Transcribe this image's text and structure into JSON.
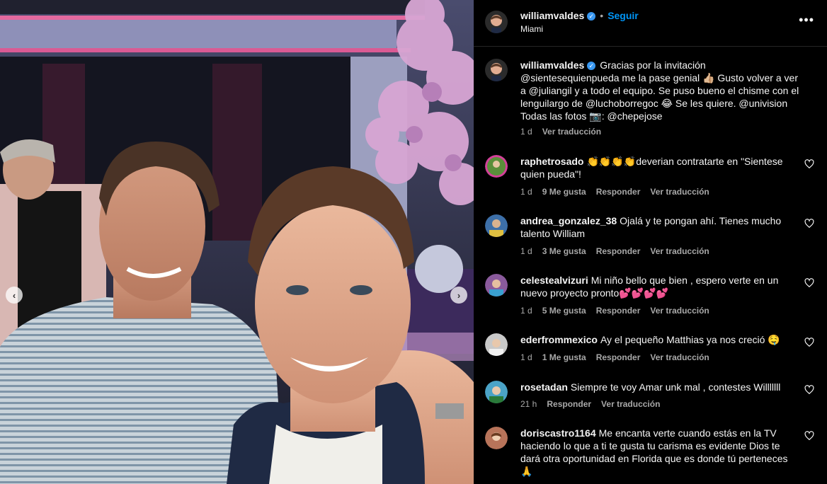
{
  "photo": {
    "prev_icon": "chevron-left",
    "next_icon": "chevron-right"
  },
  "header": {
    "username": "williamvaldes",
    "verified": true,
    "separator": "•",
    "follow_label": "Seguir",
    "location": "Miami",
    "more_icon": "ellipsis-icon",
    "more_label": "•••"
  },
  "caption": {
    "username": "williamvaldes",
    "text": "Gracias por la invitación @sientesequienpueda me la pase genial 👍🏼 Gusto volver a ver a @juliangil y a todo el equipo. Se puso bueno el chisme con el lenguilargo de @luchoborregoc 😂 Se les quiere. @univision Todas las fotos 📷: @chepejose",
    "time": "1 d",
    "translate": "Ver traducción"
  },
  "comments": [
    {
      "username": "raphetrosado",
      "text": "👏👏👏👏deverian contratarte en \"Sientese quien pueda\"!",
      "time": "1 d",
      "likes": "9 Me gusta",
      "reply": "Responder",
      "translate": "Ver traducción",
      "avatar_color": "#5a8f3a"
    },
    {
      "username": "andrea_gonzalez_38",
      "text": "Ojalá y te pongan ahí. Tienes mucho talento William",
      "time": "1 d",
      "likes": "3 Me gusta",
      "reply": "Responder",
      "translate": "Ver traducción",
      "avatar_color": "#3d6fa8"
    },
    {
      "username": "celestealvizuri",
      "text": "Mi niño bello que bien , espero verte en un nuevo proyecto pronto💕💕💕💕",
      "time": "1 d",
      "likes": "5 Me gusta",
      "reply": "Responder",
      "translate": "Ver traducción",
      "avatar_color": "#8a5a9c"
    },
    {
      "username": "ederfrommexico",
      "text": "Ay el pequeño Matthias ya nos creció 🤤",
      "time": "1 d",
      "likes": "1 Me gusta",
      "reply": "Responder",
      "translate": "Ver traducción",
      "avatar_color": "#c9c9c9"
    },
    {
      "username": "rosetadan",
      "text": "Siempre te voy Amar unk mal , contestes Willlllll",
      "time": "21 h",
      "likes": "",
      "reply": "Responder",
      "translate": "Ver traducción",
      "avatar_color": "#4ba3c7"
    },
    {
      "username": "doriscastro1164",
      "text": "Me encanta verte cuando estás en la TV haciendo lo que a ti te gusta tu carisma es evidente Dios te dará otra oportunidad en Florida que es donde tú perteneces🙏",
      "time": "",
      "likes": "",
      "reply": "",
      "translate": "",
      "avatar_color": "#b8745a"
    }
  ],
  "colors": {
    "background": "#000000",
    "text": "#f5f5f5",
    "muted": "#a8a8a8",
    "accent": "#0095f6",
    "verified": "#3897f0"
  }
}
